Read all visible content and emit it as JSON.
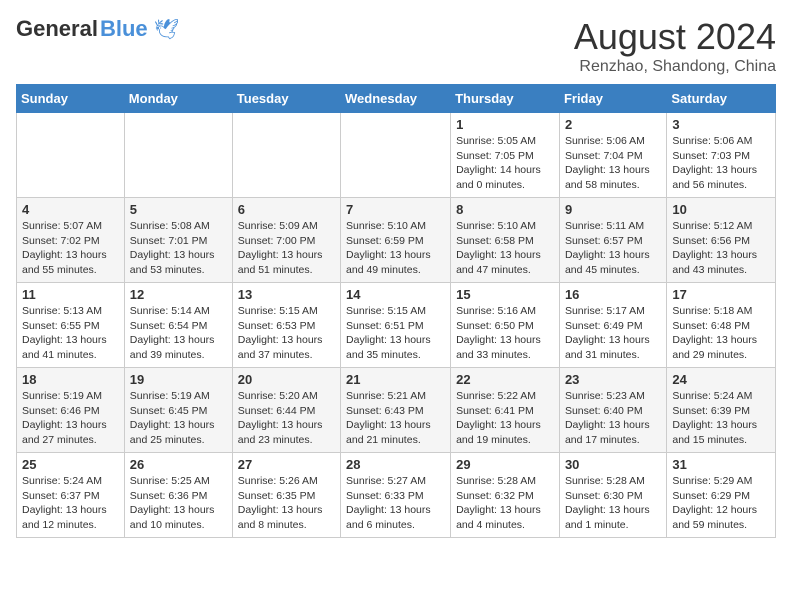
{
  "header": {
    "logo_general": "General",
    "logo_blue": "Blue",
    "month_title": "August 2024",
    "location": "Renzhao, Shandong, China"
  },
  "weekdays": [
    "Sunday",
    "Monday",
    "Tuesday",
    "Wednesday",
    "Thursday",
    "Friday",
    "Saturday"
  ],
  "weeks": [
    [
      {
        "day": "",
        "info": ""
      },
      {
        "day": "",
        "info": ""
      },
      {
        "day": "",
        "info": ""
      },
      {
        "day": "",
        "info": ""
      },
      {
        "day": "1",
        "info": "Sunrise: 5:05 AM\nSunset: 7:05 PM\nDaylight: 14 hours\nand 0 minutes."
      },
      {
        "day": "2",
        "info": "Sunrise: 5:06 AM\nSunset: 7:04 PM\nDaylight: 13 hours\nand 58 minutes."
      },
      {
        "day": "3",
        "info": "Sunrise: 5:06 AM\nSunset: 7:03 PM\nDaylight: 13 hours\nand 56 minutes."
      }
    ],
    [
      {
        "day": "4",
        "info": "Sunrise: 5:07 AM\nSunset: 7:02 PM\nDaylight: 13 hours\nand 55 minutes."
      },
      {
        "day": "5",
        "info": "Sunrise: 5:08 AM\nSunset: 7:01 PM\nDaylight: 13 hours\nand 53 minutes."
      },
      {
        "day": "6",
        "info": "Sunrise: 5:09 AM\nSunset: 7:00 PM\nDaylight: 13 hours\nand 51 minutes."
      },
      {
        "day": "7",
        "info": "Sunrise: 5:10 AM\nSunset: 6:59 PM\nDaylight: 13 hours\nand 49 minutes."
      },
      {
        "day": "8",
        "info": "Sunrise: 5:10 AM\nSunset: 6:58 PM\nDaylight: 13 hours\nand 47 minutes."
      },
      {
        "day": "9",
        "info": "Sunrise: 5:11 AM\nSunset: 6:57 PM\nDaylight: 13 hours\nand 45 minutes."
      },
      {
        "day": "10",
        "info": "Sunrise: 5:12 AM\nSunset: 6:56 PM\nDaylight: 13 hours\nand 43 minutes."
      }
    ],
    [
      {
        "day": "11",
        "info": "Sunrise: 5:13 AM\nSunset: 6:55 PM\nDaylight: 13 hours\nand 41 minutes."
      },
      {
        "day": "12",
        "info": "Sunrise: 5:14 AM\nSunset: 6:54 PM\nDaylight: 13 hours\nand 39 minutes."
      },
      {
        "day": "13",
        "info": "Sunrise: 5:15 AM\nSunset: 6:53 PM\nDaylight: 13 hours\nand 37 minutes."
      },
      {
        "day": "14",
        "info": "Sunrise: 5:15 AM\nSunset: 6:51 PM\nDaylight: 13 hours\nand 35 minutes."
      },
      {
        "day": "15",
        "info": "Sunrise: 5:16 AM\nSunset: 6:50 PM\nDaylight: 13 hours\nand 33 minutes."
      },
      {
        "day": "16",
        "info": "Sunrise: 5:17 AM\nSunset: 6:49 PM\nDaylight: 13 hours\nand 31 minutes."
      },
      {
        "day": "17",
        "info": "Sunrise: 5:18 AM\nSunset: 6:48 PM\nDaylight: 13 hours\nand 29 minutes."
      }
    ],
    [
      {
        "day": "18",
        "info": "Sunrise: 5:19 AM\nSunset: 6:46 PM\nDaylight: 13 hours\nand 27 minutes."
      },
      {
        "day": "19",
        "info": "Sunrise: 5:19 AM\nSunset: 6:45 PM\nDaylight: 13 hours\nand 25 minutes."
      },
      {
        "day": "20",
        "info": "Sunrise: 5:20 AM\nSunset: 6:44 PM\nDaylight: 13 hours\nand 23 minutes."
      },
      {
        "day": "21",
        "info": "Sunrise: 5:21 AM\nSunset: 6:43 PM\nDaylight: 13 hours\nand 21 minutes."
      },
      {
        "day": "22",
        "info": "Sunrise: 5:22 AM\nSunset: 6:41 PM\nDaylight: 13 hours\nand 19 minutes."
      },
      {
        "day": "23",
        "info": "Sunrise: 5:23 AM\nSunset: 6:40 PM\nDaylight: 13 hours\nand 17 minutes."
      },
      {
        "day": "24",
        "info": "Sunrise: 5:24 AM\nSunset: 6:39 PM\nDaylight: 13 hours\nand 15 minutes."
      }
    ],
    [
      {
        "day": "25",
        "info": "Sunrise: 5:24 AM\nSunset: 6:37 PM\nDaylight: 13 hours\nand 12 minutes."
      },
      {
        "day": "26",
        "info": "Sunrise: 5:25 AM\nSunset: 6:36 PM\nDaylight: 13 hours\nand 10 minutes."
      },
      {
        "day": "27",
        "info": "Sunrise: 5:26 AM\nSunset: 6:35 PM\nDaylight: 13 hours\nand 8 minutes."
      },
      {
        "day": "28",
        "info": "Sunrise: 5:27 AM\nSunset: 6:33 PM\nDaylight: 13 hours\nand 6 minutes."
      },
      {
        "day": "29",
        "info": "Sunrise: 5:28 AM\nSunset: 6:32 PM\nDaylight: 13 hours\nand 4 minutes."
      },
      {
        "day": "30",
        "info": "Sunrise: 5:28 AM\nSunset: 6:30 PM\nDaylight: 13 hours\nand 1 minute."
      },
      {
        "day": "31",
        "info": "Sunrise: 5:29 AM\nSunset: 6:29 PM\nDaylight: 12 hours\nand 59 minutes."
      }
    ]
  ]
}
